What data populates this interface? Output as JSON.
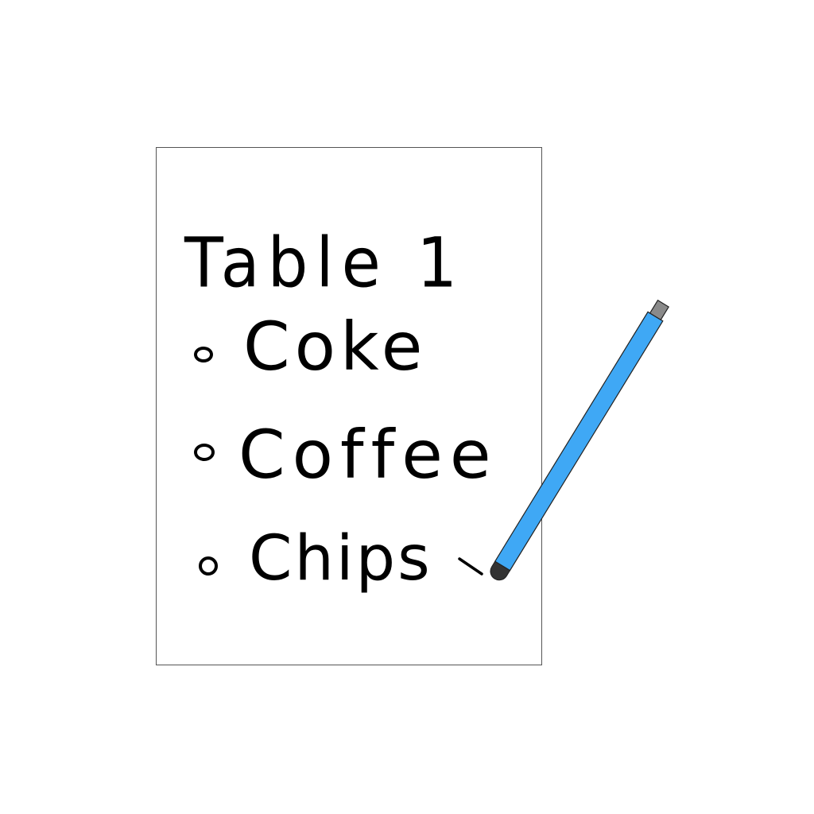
{
  "note": {
    "title": "Table 1",
    "items": [
      {
        "label": "Coke"
      },
      {
        "label": "Coffee"
      },
      {
        "label": "Chips"
      }
    ]
  },
  "colors": {
    "paper_border": "#555555",
    "ink": "#000000",
    "pen_body": "#3fa8f5",
    "pen_cap": "#8a8a8a",
    "pen_tip": "#333333"
  },
  "icons": {
    "pen": "pen-icon",
    "bullet": "circle-bullet-icon"
  }
}
